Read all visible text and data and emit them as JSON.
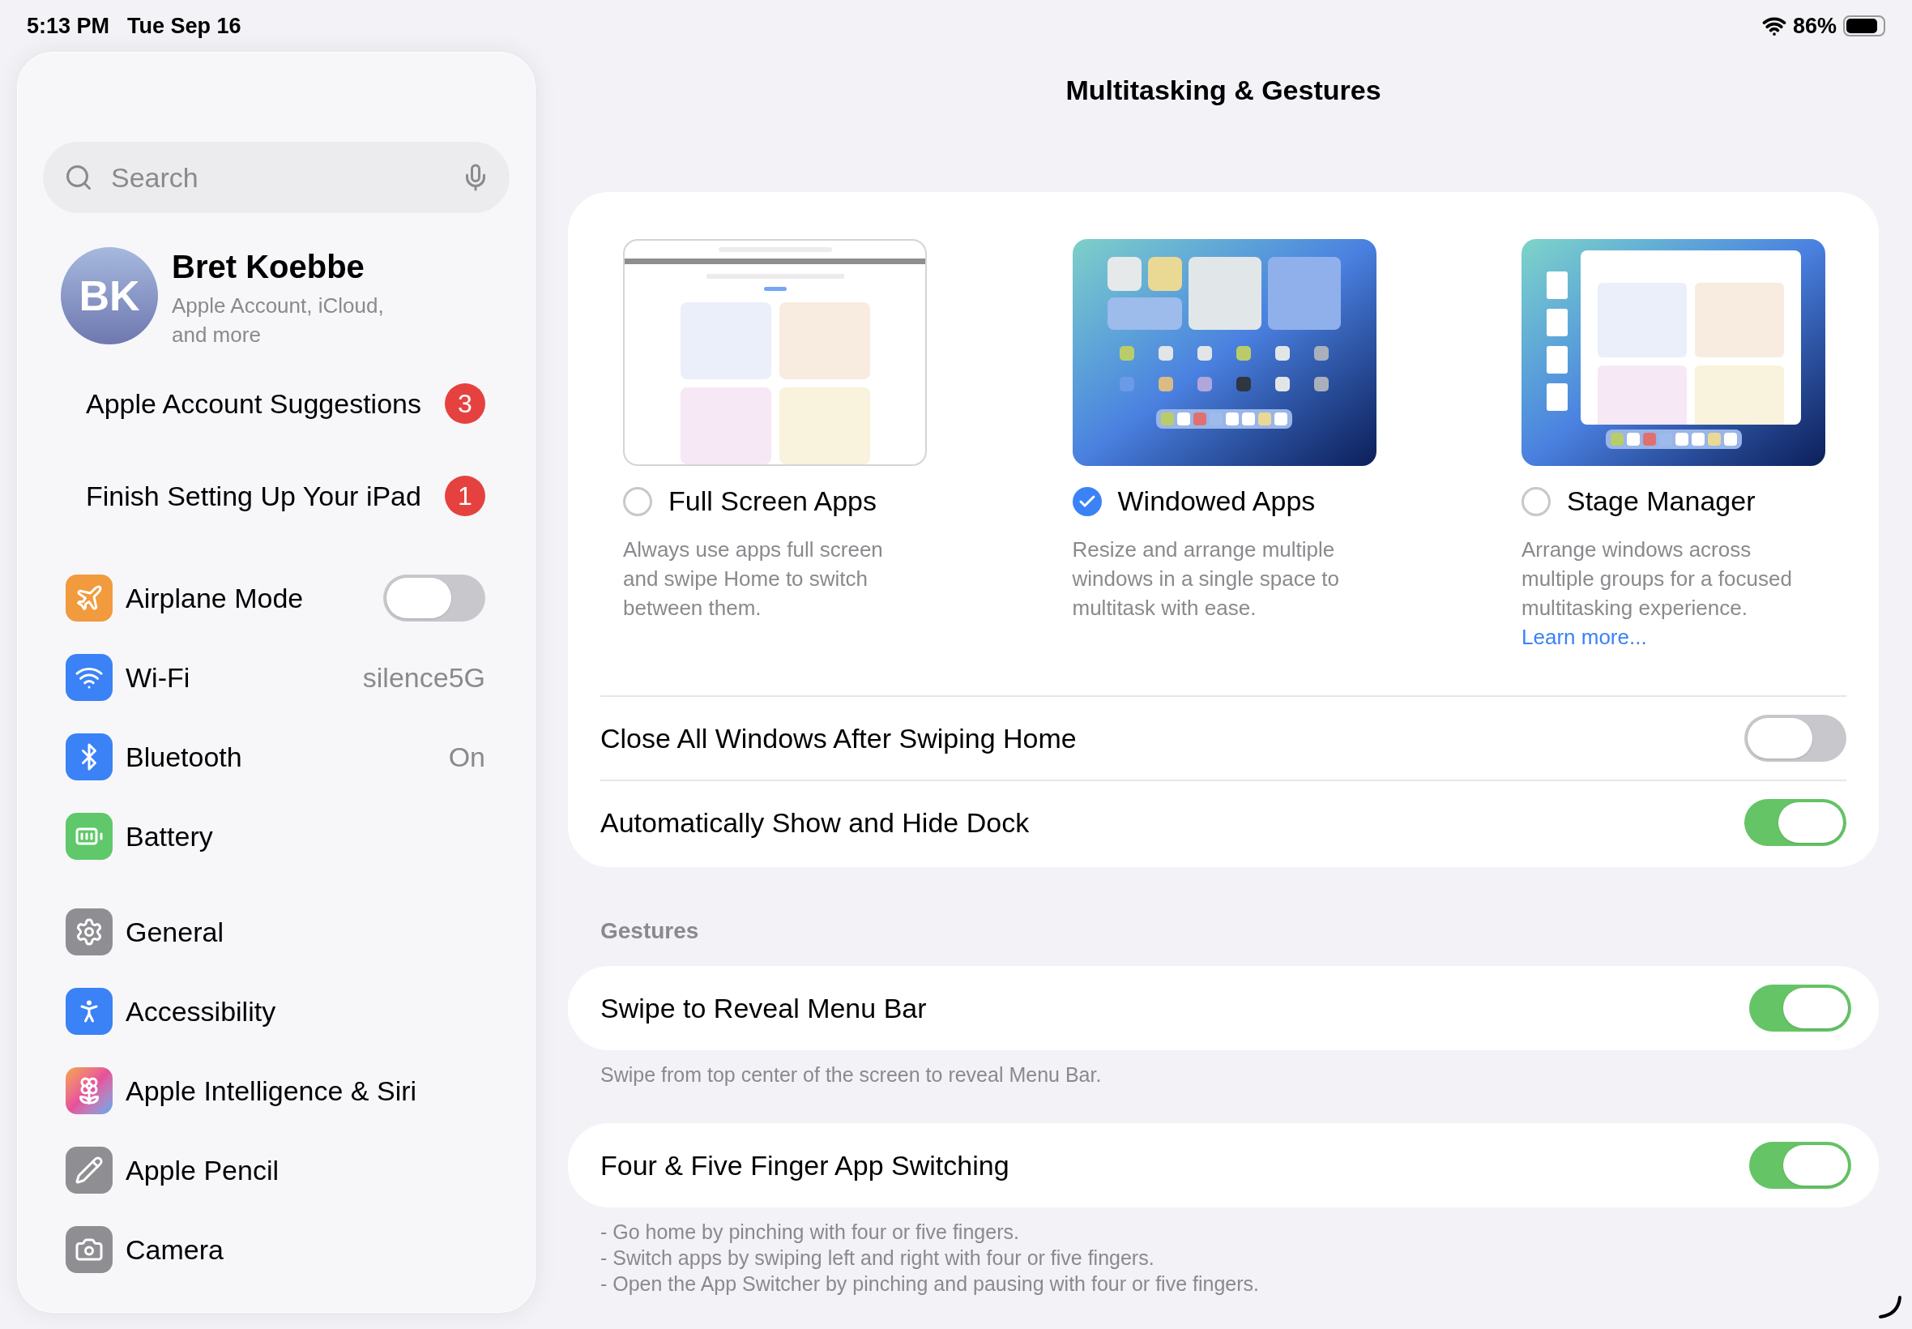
{
  "status_bar": {
    "time": "5:13 PM",
    "date": "Tue Sep 16",
    "battery": "86%"
  },
  "sidebar": {
    "search": {
      "placeholder": "Search"
    },
    "profile": {
      "initials": "BK",
      "name": "Bret Koebbe",
      "subtitle": "Apple Account, iCloud, and more"
    },
    "notices": [
      {
        "label": "Apple Account Suggestions",
        "badge": "3"
      },
      {
        "label": "Finish Setting Up Your iPad",
        "badge": "1"
      }
    ],
    "groups": [
      [
        {
          "kind": "toggle",
          "label": "Airplane Mode",
          "on": false
        },
        {
          "kind": "value",
          "label": "Wi-Fi",
          "value": "silence5G"
        },
        {
          "kind": "value",
          "label": "Bluetooth",
          "value": "On"
        },
        {
          "kind": "link",
          "label": "Battery"
        }
      ],
      [
        {
          "kind": "link",
          "label": "General"
        },
        {
          "kind": "link",
          "label": "Accessibility"
        },
        {
          "kind": "link",
          "label": "Apple Intelligence & Siri"
        },
        {
          "kind": "link",
          "label": "Apple Pencil"
        },
        {
          "kind": "link",
          "label": "Camera"
        }
      ]
    ]
  },
  "page": {
    "title": "Multitasking & Gestures",
    "modes": [
      {
        "label": "Full Screen Apps",
        "selected": false,
        "description": "Always use apps full screen and swipe Home to switch between them."
      },
      {
        "label": "Windowed Apps",
        "selected": true,
        "description": "Resize and arrange multiple windows in a single space to multitask with ease."
      },
      {
        "label": "Stage Manager",
        "selected": false,
        "description": "Arrange windows across multiple groups for a focused multitasking experience.",
        "link": "Learn more..."
      }
    ],
    "options": [
      {
        "label": "Close All Windows After Swiping Home",
        "on": false
      },
      {
        "label": "Automatically Show and Hide Dock",
        "on": true
      }
    ],
    "gestures": {
      "header": "Gestures",
      "items": [
        {
          "label": "Swipe to Reveal Menu Bar",
          "on": true,
          "footer": [
            "Swipe from top center of the screen to reveal Menu Bar."
          ]
        },
        {
          "label": "Four & Five Finger App Switching",
          "on": true,
          "footer": [
            "- Go home by pinching with four or five fingers.",
            "- Switch apps by swiping left and right with four or five fingers.",
            "- Open the App Switcher by pinching and pausing with four or five fingers."
          ]
        }
      ]
    }
  }
}
